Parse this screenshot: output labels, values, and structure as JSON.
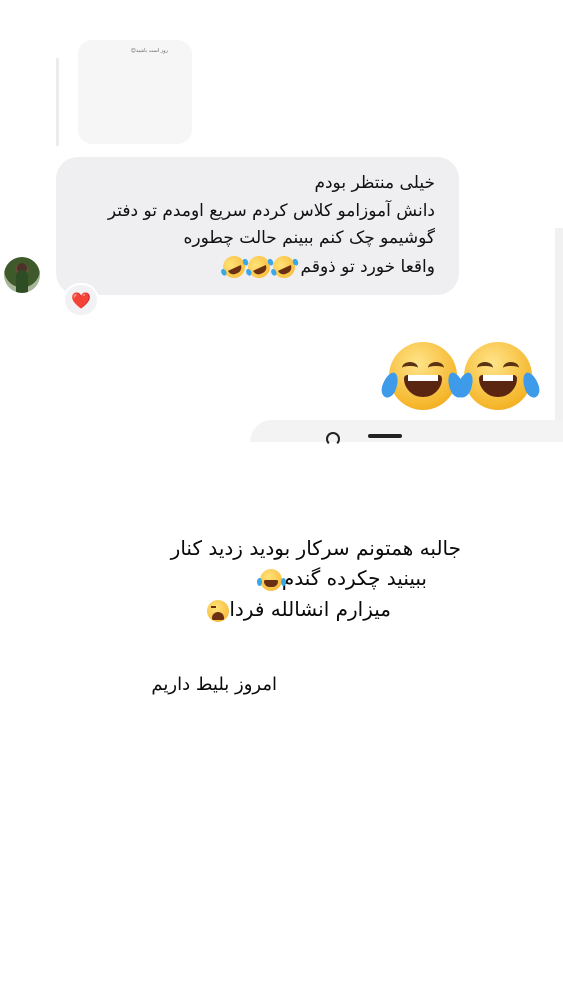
{
  "shared_card": {
    "text": "روز است باشید😊"
  },
  "message": {
    "lines": [
      "خیلی منتظر بودم",
      "دانش آموزامو کلاس کردم سریع اومدم تو دفتر",
      "گوشیمو چک کنم ببینم حالت چطوره",
      "واقعا خورد تو ذوقم"
    ],
    "trailing_emoji": [
      "rolling-on-floor-laughing",
      "rolling-on-floor-laughing",
      "rolling-on-floor-laughing"
    ],
    "reaction": "❤️"
  },
  "sent_emoji": [
    "face-with-tears-of-joy",
    "face-with-tears-of-joy"
  ],
  "caption": {
    "line1": "جالبه همتونم سرکار بودید زدید کنار",
    "line2": "ببینید چکرده گندم",
    "line3": "میزارم انشالله فردا",
    "line4": "امروز بلیط داریم",
    "line2_emoji": "face-with-tears-of-joy",
    "line3_emoji": "weary-face"
  },
  "colors": {
    "bubble_bg": "#efeff1",
    "page_bg": "#ffffff",
    "heart": "#e0244a"
  }
}
